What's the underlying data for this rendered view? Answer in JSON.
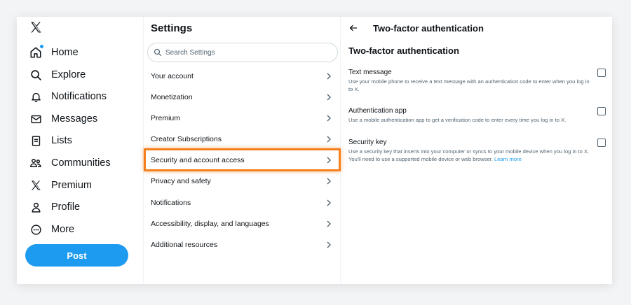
{
  "nav": {
    "items": [
      {
        "label": "Home",
        "icon": "home-icon"
      },
      {
        "label": "Explore",
        "icon": "search-icon"
      },
      {
        "label": "Notifications",
        "icon": "bell-icon"
      },
      {
        "label": "Messages",
        "icon": "envelope-icon"
      },
      {
        "label": "Lists",
        "icon": "list-icon"
      },
      {
        "label": "Communities",
        "icon": "people-icon"
      },
      {
        "label": "Premium",
        "icon": "x-logo-icon"
      },
      {
        "label": "Profile",
        "icon": "person-icon"
      },
      {
        "label": "More",
        "icon": "more-circle-icon"
      }
    ],
    "post_label": "Post"
  },
  "settings": {
    "title": "Settings",
    "search_placeholder": "Search Settings",
    "items": [
      {
        "label": "Your account"
      },
      {
        "label": "Monetization"
      },
      {
        "label": "Premium"
      },
      {
        "label": "Creator Subscriptions"
      },
      {
        "label": "Security and account access"
      },
      {
        "label": "Privacy and safety"
      },
      {
        "label": "Notifications"
      },
      {
        "label": "Accessibility, display, and languages"
      },
      {
        "label": "Additional resources"
      }
    ],
    "highlighted_item": "Security and account access"
  },
  "detail": {
    "header": "Two-factor authentication",
    "title": "Two-factor authentication",
    "options": [
      {
        "title": "Text message",
        "desc": "Use your mobile phone to receive a text message with an authentication code to enter when you log in to X.",
        "checked": false
      },
      {
        "title": "Authentication app",
        "desc": "Use a mobile authentication app to get a verification code to enter every time you log in to X.",
        "checked": false
      },
      {
        "title": "Security key",
        "desc": "Use a security key that inserts into your computer or syncs to your mobile device when you log in to X. You'll need to use a supported mobile device or web browser. ",
        "link": "Learn more",
        "checked": false
      }
    ]
  },
  "colors": {
    "accent": "#1d9bf0",
    "highlight": "#f47f1f",
    "text": "#0f1419",
    "muted": "#536471"
  }
}
